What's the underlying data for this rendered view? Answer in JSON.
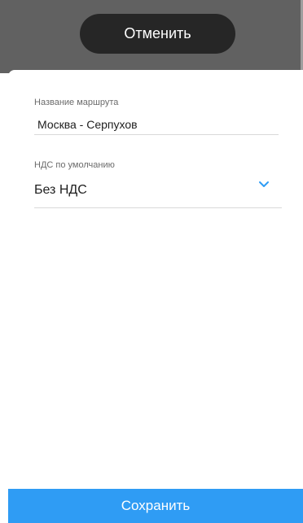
{
  "cancel_button": {
    "label": "Отменить"
  },
  "form": {
    "route_name": {
      "label": "Название маршрута",
      "value": "Москва - Серпухов"
    },
    "vat": {
      "label": "НДС по умолчанию",
      "value": "Без НДС",
      "icon": "chevron-down-icon"
    }
  },
  "save_button": {
    "label": "Сохранить"
  },
  "colors": {
    "overlay": "#616161",
    "cancel_button_bg": "#262626",
    "accent": "#2f9cf4",
    "sheet_bg": "#ffffff"
  }
}
